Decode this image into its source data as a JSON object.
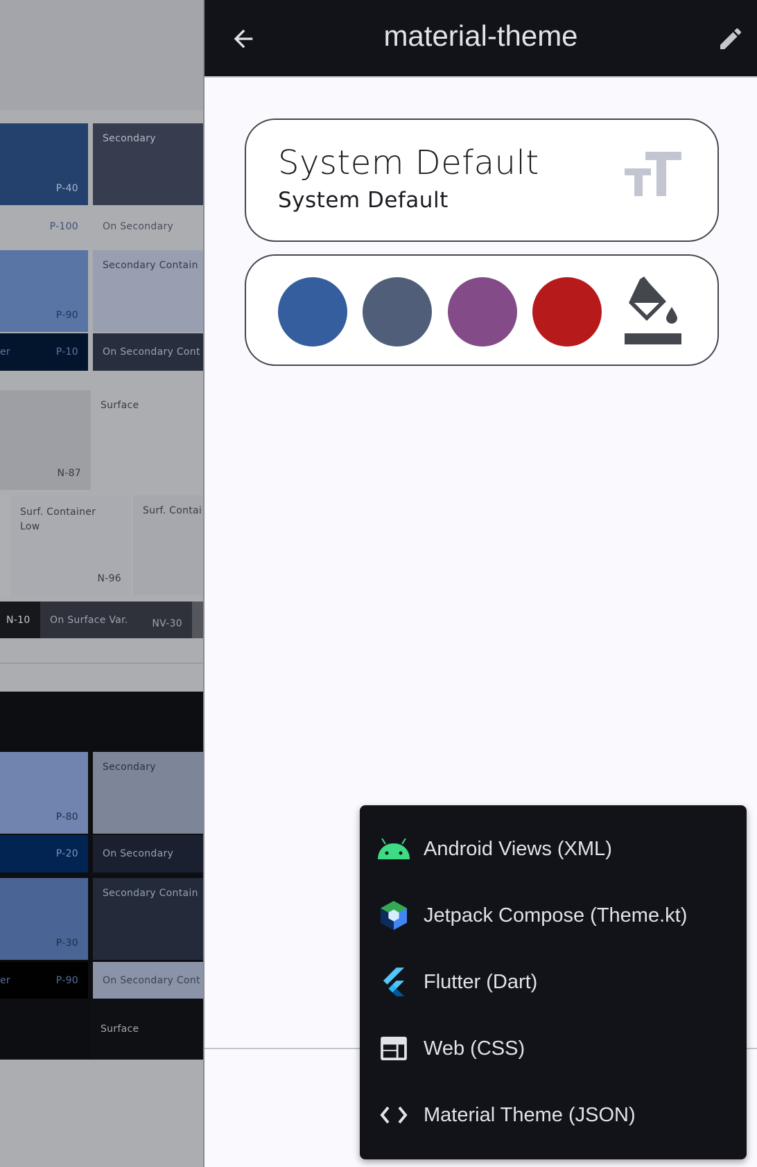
{
  "app_bar": {
    "title": "material-theme",
    "back_icon": "arrow-left-icon",
    "edit_icon": "pencil-icon"
  },
  "font_card": {
    "headline": "System Default",
    "subhead": "System Default",
    "icon": "text-fields-icon"
  },
  "color_card": {
    "swatches": [
      {
        "name": "primary",
        "color": "#355e9f"
      },
      {
        "name": "secondary",
        "color": "#505e7a"
      },
      {
        "name": "tertiary",
        "color": "#834b87"
      },
      {
        "name": "error",
        "color": "#b71a1b"
      }
    ],
    "icon": "format-color-fill-icon"
  },
  "export_menu": {
    "items": [
      {
        "label": "Android Views (XML)",
        "icon": "android-icon"
      },
      {
        "label": "Jetpack Compose (Theme.kt)",
        "icon": "jetpack-compose-icon"
      },
      {
        "label": "Flutter (Dart)",
        "icon": "flutter-icon"
      },
      {
        "label": "Web (CSS)",
        "icon": "web-icon"
      },
      {
        "label": "Material Theme (JSON)",
        "icon": "code-icon"
      }
    ]
  },
  "background_scheme": {
    "light": {
      "primary_tone": "P-40",
      "on_primary_tone": "P-100",
      "secondary_label": "Secondary",
      "on_secondary_label": "On Secondary",
      "primary_container_tone": "P-90",
      "on_primary_container_partial": "er",
      "on_primary_container_tone": "P-10",
      "secondary_container_label": "Secondary Contain",
      "on_secondary_container_label": "On Secondary Cont",
      "surface_dim_tone": "N-87",
      "surface_label": "Surface",
      "surf_container_low_label": "Surf. Container Low",
      "surf_container_low_tone": "N-96",
      "surf_container_label": "Surf. Contai",
      "on_surface_tone": "N-10",
      "on_surface_var_label": "On Surface Var.",
      "on_surface_var_tone": "NV-30"
    },
    "dark": {
      "primary_tone": "P-80",
      "on_primary_tone": "P-20",
      "secondary_label": "Secondary",
      "on_secondary_label": "On Secondary",
      "primary_container_tone": "P-30",
      "on_primary_container_partial": "er",
      "on_primary_container_tone": "P-90",
      "secondary_container_label": "Secondary Contain",
      "on_secondary_container_label": "On Secondary Cont",
      "surface_label": "Surface"
    }
  }
}
